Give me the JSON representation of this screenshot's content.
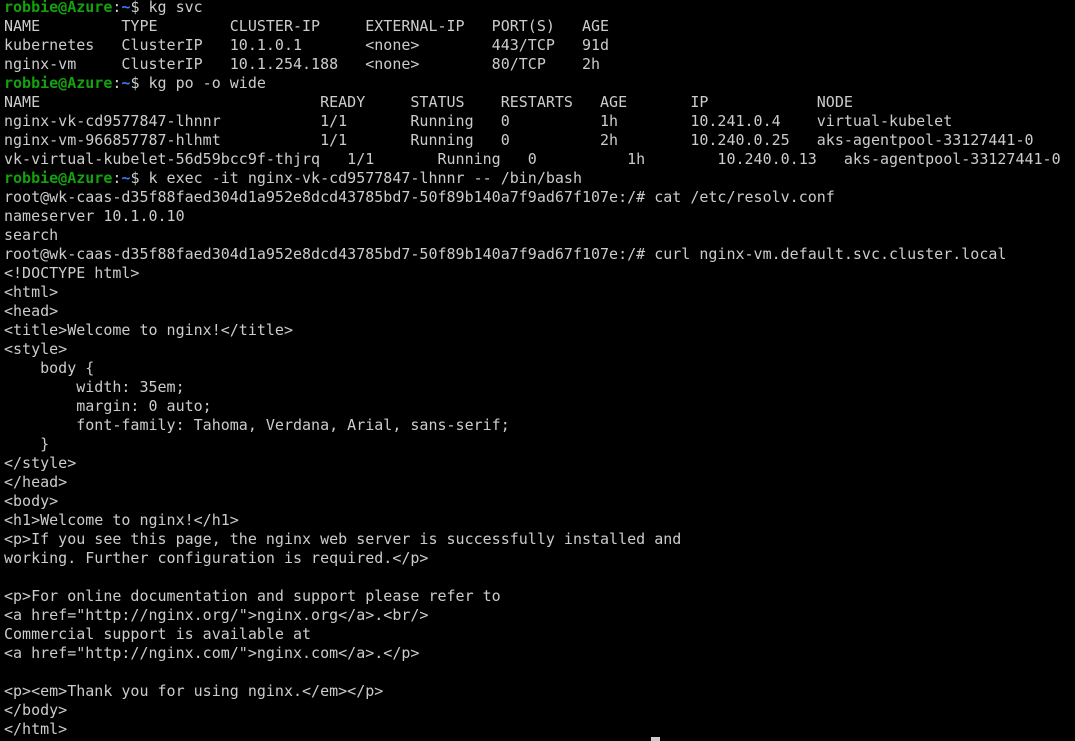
{
  "terminal": {
    "prompt": {
      "user_host": "robbie@Azure",
      "separator": ":",
      "path": "~",
      "symbol": "$ "
    },
    "lines": [
      {
        "type": "prompt",
        "command": "kg svc"
      },
      {
        "type": "output",
        "text": "NAME         TYPE        CLUSTER-IP     EXTERNAL-IP   PORT(S)   AGE"
      },
      {
        "type": "output",
        "text": "kubernetes   ClusterIP   10.1.0.1       <none>        443/TCP   91d"
      },
      {
        "type": "output",
        "text": "nginx-vm     ClusterIP   10.1.254.188   <none>        80/TCP    2h"
      },
      {
        "type": "prompt",
        "command": "kg po -o wide"
      },
      {
        "type": "output",
        "text": "NAME                               READY     STATUS    RESTARTS   AGE       IP            NODE"
      },
      {
        "type": "output",
        "text": "nginx-vk-cd9577847-lhnnr           1/1       Running   0          1h        10.241.0.4    virtual-kubelet"
      },
      {
        "type": "output",
        "text": "nginx-vm-966857787-hlhmt           1/1       Running   0          2h        10.240.0.25   aks-agentpool-33127441-0"
      },
      {
        "type": "output",
        "text": "vk-virtual-kubelet-56d59bcc9f-thjrq   1/1       Running   0          1h        10.240.0.13   aks-agentpool-33127441-0"
      },
      {
        "type": "prompt",
        "command": "k exec -it nginx-vk-cd9577847-lhnnr -- /bin/bash"
      },
      {
        "type": "output",
        "text": "root@wk-caas-d35f88faed304d1a952e8dcd43785bd7-50f89b140a7f9ad67f107e:/# cat /etc/resolv.conf"
      },
      {
        "type": "output",
        "text": "nameserver 10.1.0.10"
      },
      {
        "type": "output",
        "text": "search"
      },
      {
        "type": "output",
        "text": "root@wk-caas-d35f88faed304d1a952e8dcd43785bd7-50f89b140a7f9ad67f107e:/# curl nginx-vm.default.svc.cluster.local"
      },
      {
        "type": "output",
        "text": "<!DOCTYPE html>"
      },
      {
        "type": "output",
        "text": "<html>"
      },
      {
        "type": "output",
        "text": "<head>"
      },
      {
        "type": "output",
        "text": "<title>Welcome to nginx!</title>"
      },
      {
        "type": "output",
        "text": "<style>"
      },
      {
        "type": "output",
        "text": "    body {"
      },
      {
        "type": "output",
        "text": "        width: 35em;"
      },
      {
        "type": "output",
        "text": "        margin: 0 auto;"
      },
      {
        "type": "output",
        "text": "        font-family: Tahoma, Verdana, Arial, sans-serif;"
      },
      {
        "type": "output",
        "text": "    }"
      },
      {
        "type": "output",
        "text": "</style>"
      },
      {
        "type": "output",
        "text": "</head>"
      },
      {
        "type": "output",
        "text": "<body>"
      },
      {
        "type": "output",
        "text": "<h1>Welcome to nginx!</h1>"
      },
      {
        "type": "output",
        "text": "<p>If you see this page, the nginx web server is successfully installed and"
      },
      {
        "type": "output",
        "text": "working. Further configuration is required.</p>"
      },
      {
        "type": "output",
        "text": ""
      },
      {
        "type": "output",
        "text": "<p>For online documentation and support please refer to"
      },
      {
        "type": "output",
        "text": "<a href=\"http://nginx.org/\">nginx.org</a>.<br/>"
      },
      {
        "type": "output",
        "text": "Commercial support is available at"
      },
      {
        "type": "output",
        "text": "<a href=\"http://nginx.com/\">nginx.com</a>.</p>"
      },
      {
        "type": "output",
        "text": ""
      },
      {
        "type": "output",
        "text": "<p><em>Thank you for using nginx.</em></p>"
      },
      {
        "type": "output",
        "text": "</body>"
      },
      {
        "type": "output",
        "text": "</html>"
      }
    ]
  },
  "colors": {
    "background": "#000000",
    "foreground": "#cccccc",
    "prompt_user": "#13a10e",
    "prompt_path": "#3b78ff"
  }
}
